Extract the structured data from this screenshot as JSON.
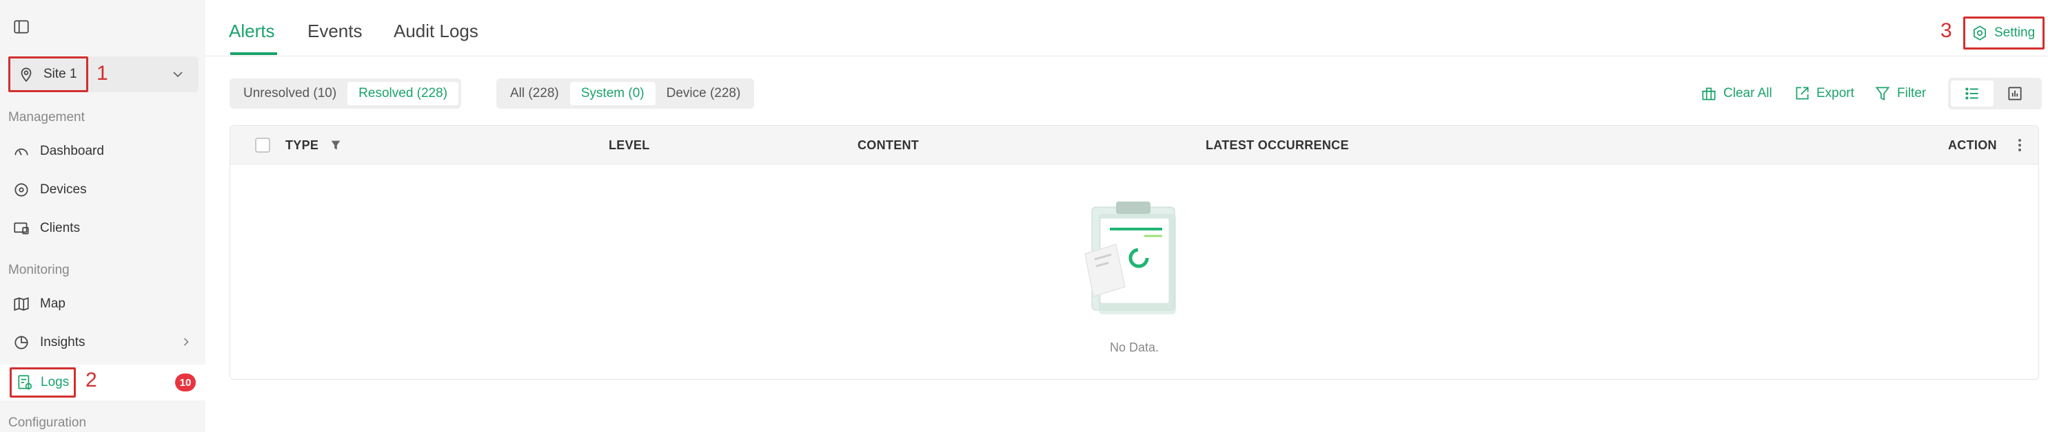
{
  "sidebar": {
    "site": {
      "label": "Site 1"
    },
    "sections": {
      "management": "Management",
      "monitoring": "Monitoring",
      "configuration": "Configuration"
    },
    "items": {
      "dashboard": "Dashboard",
      "devices": "Devices",
      "clients": "Clients",
      "map": "Map",
      "insights": "Insights",
      "logs": "Logs"
    },
    "logs_badge": "10"
  },
  "annotations": {
    "one": "1",
    "two": "2",
    "three": "3"
  },
  "tabs": [
    {
      "label": "Alerts",
      "active": true
    },
    {
      "label": "Events",
      "active": false
    },
    {
      "label": "Audit Logs",
      "active": false
    }
  ],
  "header": {
    "setting_label": "Setting"
  },
  "filters": {
    "status": [
      {
        "label": "Unresolved (10)",
        "active": false
      },
      {
        "label": "Resolved (228)",
        "active": true
      }
    ],
    "source": [
      {
        "label": "All (228)",
        "active": false
      },
      {
        "label": "System (0)",
        "active": true
      },
      {
        "label": "Device (228)",
        "active": false
      }
    ]
  },
  "toolbar": {
    "clear_all": "Clear All",
    "export": "Export",
    "filter": "Filter"
  },
  "table": {
    "columns": [
      "TYPE",
      "LEVEL",
      "CONTENT",
      "LATEST OCCURRENCE",
      "ACTION"
    ],
    "empty_text": "No Data."
  },
  "colors": {
    "accent": "#1aa36b",
    "annotation": "#d32f2f",
    "badge": "#e8343f"
  }
}
